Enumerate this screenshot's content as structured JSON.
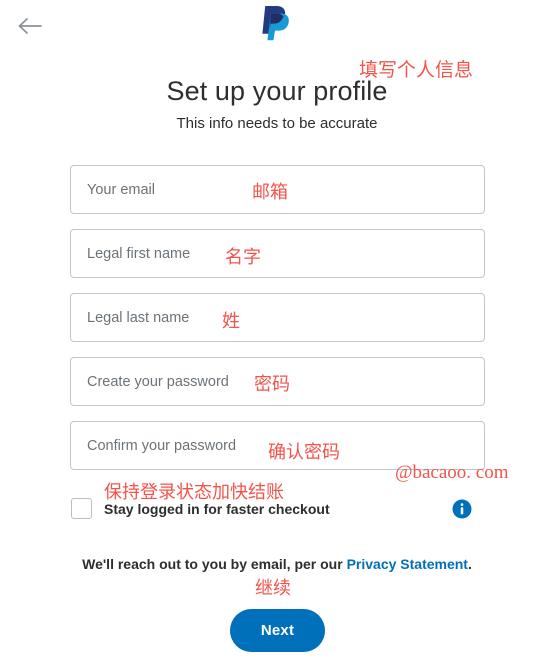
{
  "nav": {
    "back_icon": "back-arrow-icon"
  },
  "brand": {
    "logo_icon": "paypal-logo-icon",
    "name": "PayPal",
    "dark_blue": "#253b80",
    "light_blue": "#179bd7"
  },
  "header": {
    "title": "Set up your profile",
    "subtitle": "This info needs to be accurate"
  },
  "form": {
    "fields": [
      {
        "name": "email",
        "label": "Your email",
        "value": "",
        "placeholder": "Your email"
      },
      {
        "name": "first-name",
        "label": "Legal first name",
        "value": "",
        "placeholder": "Legal first name"
      },
      {
        "name": "last-name",
        "label": "Legal last name",
        "value": "",
        "placeholder": "Legal last name"
      },
      {
        "name": "password",
        "label": "Create your password",
        "value": "",
        "placeholder": "Create your password"
      },
      {
        "name": "confirm-password",
        "label": "Confirm your password",
        "value": "",
        "placeholder": "Confirm your password"
      }
    ],
    "stay_logged_in": {
      "label": "Stay logged in for faster checkout",
      "checked": false,
      "info_icon": "info-circle-icon"
    }
  },
  "footer": {
    "privacy_text_before": "We'll reach out to you by email, per our ",
    "privacy_link": "Privacy Statement",
    "privacy_text_after": ".",
    "next_label": "Next",
    "next_color": "#0070ba",
    "link_color": "#0070ba"
  },
  "annotations": {
    "color": "#f4534b",
    "header": "填写个人信息",
    "email": "邮箱",
    "first_name": "名字",
    "last_name": "姓",
    "password": "密码",
    "confirm_password": "确认密码",
    "stay_logged_in": "保持登录状态加快结账",
    "next": "继续"
  },
  "watermark": {
    "text": "@bacaoo. com"
  }
}
